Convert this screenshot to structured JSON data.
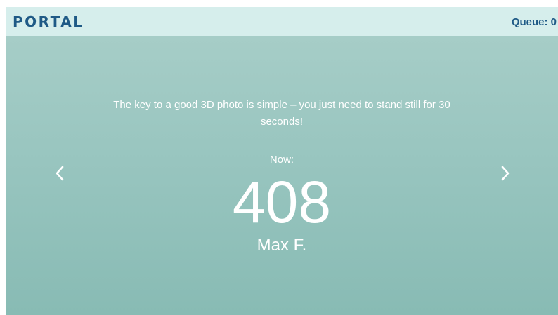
{
  "header": {
    "brand": "PORTAL",
    "queue_label": "Queue: 0"
  },
  "main": {
    "tip": "The key to a good 3D photo is simple – you just need to stand still for 30 seconds!",
    "now_label": "Now:",
    "current_number": "408",
    "current_name": "Max F."
  },
  "nav": {
    "prev_icon": "chevron-left-icon",
    "next_icon": "chevron-right-icon"
  },
  "colors": {
    "header_bg": "#d6eeec",
    "brand": "#1f5a86",
    "stage_top": "#a6cdc7",
    "stage_bottom": "#88bbb4",
    "text": "#ffffff"
  }
}
